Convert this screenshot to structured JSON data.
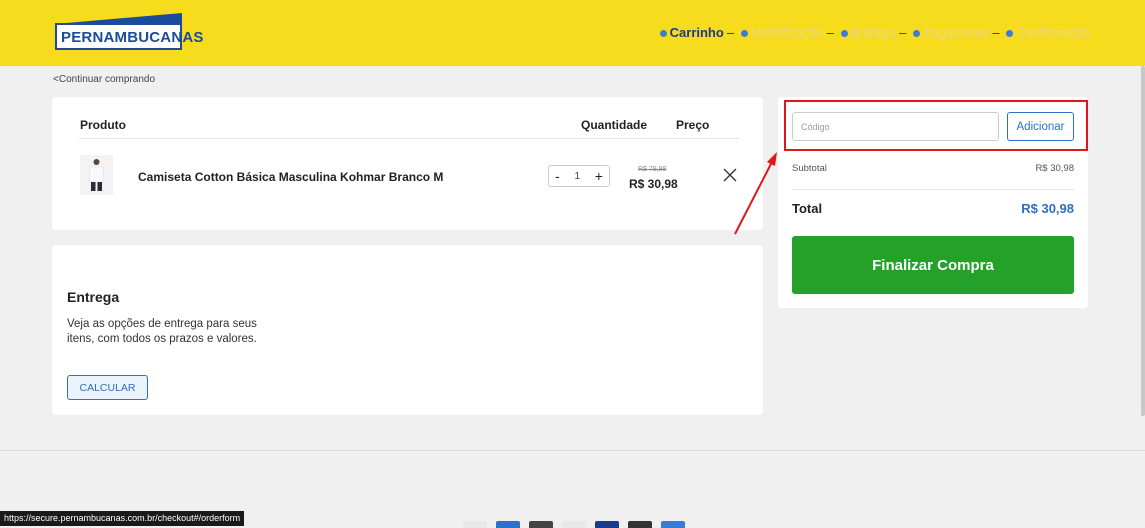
{
  "brand": {
    "logo_text": "PERNAMBUCANAS"
  },
  "steps": [
    {
      "label": "Carrinho",
      "active": true
    },
    {
      "label": "Identificação",
      "active": false
    },
    {
      "label": "Entrega",
      "active": false
    },
    {
      "label": "Pagamento",
      "active": false
    },
    {
      "label": "Confirmação",
      "active": false
    }
  ],
  "back_link": "Continuar comprando",
  "cart": {
    "headers": {
      "product": "Produto",
      "quantity": "Quantidade",
      "price": "Preço"
    },
    "item": {
      "name": "Camiseta Cotton Básica Masculina Kohmar Branco M",
      "quantity": "1",
      "minus": "-",
      "plus": "+",
      "old_price": "R$ 79,99",
      "price": "R$ 30,98"
    }
  },
  "shipping": {
    "title": "Entrega",
    "description": "Veja as opções de entrega para seus itens, com todos os prazos e valores.",
    "button": "CALCULAR"
  },
  "summary": {
    "coupon_placeholder": "Código",
    "coupon_button": "Adicionar",
    "subtotal_label": "Subtotal",
    "subtotal_value": "R$ 30,98",
    "total_label": "Total",
    "total_value": "R$ 30,98",
    "finalize_button": "Finalizar Compra"
  },
  "status_url": "https://secure.pernambucanas.com.br/checkout#/orderform",
  "colors": {
    "header_bg": "#f7dc1e",
    "brand_blue": "#1b4b9b",
    "accent_blue": "#2f6fc7",
    "finalize_green": "#24a129",
    "highlight_red": "#e0161b"
  }
}
